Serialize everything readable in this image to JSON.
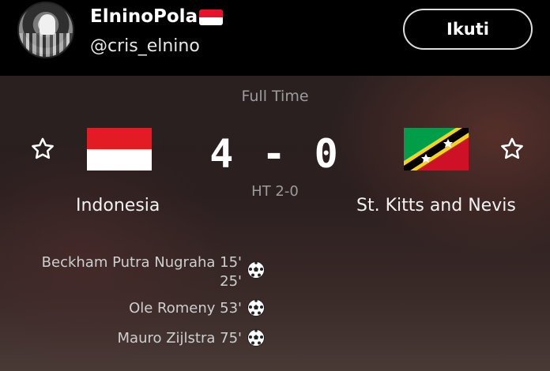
{
  "header": {
    "display_name": "ElninoPola",
    "name_emoji": "indonesia-flag-emoji",
    "handle": "@cris_elnino",
    "follow_label": "Ikuti"
  },
  "match": {
    "status": "Full Time",
    "score": "4 - 0",
    "half_time": "HT 2-0",
    "home_team": "Indonesia",
    "away_team": "St. Kitts and Nevis",
    "scorers": [
      {
        "name": "Beckham Putra Nugraha 15'",
        "extra": "25'"
      },
      {
        "name": "Ole Romeny 53'"
      },
      {
        "name": "Mauro Zijlstra 75'"
      }
    ]
  },
  "colors": {
    "accent": "#ffffff",
    "indonesia_red": "#e31b23",
    "skn_green": "#009e49",
    "skn_red": "#ce1126",
    "skn_yellow": "#fcd116"
  }
}
